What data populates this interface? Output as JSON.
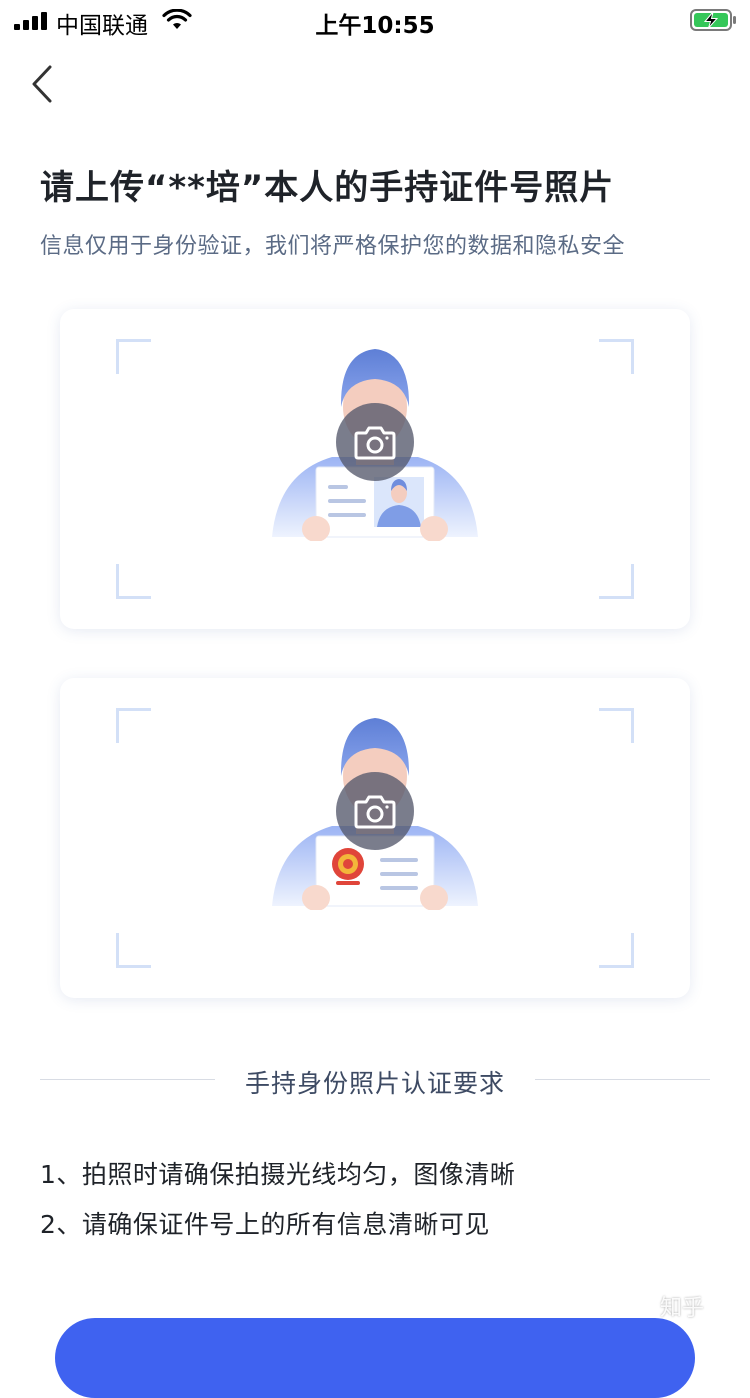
{
  "status_bar": {
    "carrier": "中国联通",
    "time": "上午10:55"
  },
  "header": {
    "title": "请上传“**培”本人的手持证件号照片",
    "subtitle": "信息仅用于身份验证，我们将严格保护您的数据和隐私安全"
  },
  "requirements": {
    "title": "手持身份照片认证要求",
    "items": [
      "1、拍照时请确保拍摄光线均匀，图像清晰",
      "2、请确保证件号上的所有信息清晰可见"
    ]
  },
  "watermark": "知乎",
  "colors": {
    "accent": "#3f62f0",
    "subtitle": "#5b6b85",
    "frame_corner": "#d3e0f7"
  },
  "icons": {
    "back": "chevron-left-icon",
    "camera": "camera-icon"
  }
}
